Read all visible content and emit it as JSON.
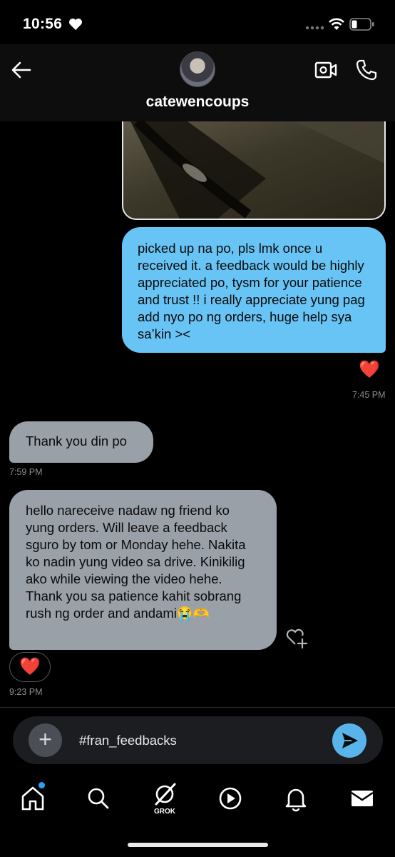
{
  "status_bar": {
    "time": "10:56"
  },
  "header": {
    "username": "catewencoups"
  },
  "messages": {
    "sent_text": "picked up na po, pls lmk once u received it. a feedback would be highly appreciated po, tysm for your patience and trust !! i really appreciate yung pag add nyo po ng orders, huge help sya sa’kin ><",
    "sent_reaction": "❤️",
    "sent_time": "7:45 PM",
    "received_1_text": "Thank you din po",
    "received_1_time": "7:59 PM",
    "received_2_text": "hello nareceive nadaw ng friend ko yung orders. Will leave a feedback sguro by tom or Monday hehe. Nakita ko nadin yung video sa drive. Kinikilig ako while viewing the video hehe. Thank you sa patience kahit sobrang rush ng order and andami😭🫶",
    "received_2_reaction": "❤️",
    "received_2_time": "9:23 PM"
  },
  "composer": {
    "value": "#fran_feedbacks",
    "add_icon": "plus-icon",
    "send_icon": "send-icon"
  },
  "nav": {
    "grok_label": "GROK",
    "icons": [
      "home-icon",
      "search-icon",
      "grok-icon",
      "video-icon",
      "bell-icon",
      "mail-icon"
    ]
  },
  "colors": {
    "sent_bubble": "#68c4f5",
    "received_bubble": "#9aa0a8",
    "accent": "#2aa0f0",
    "reaction": "#e8262f"
  }
}
